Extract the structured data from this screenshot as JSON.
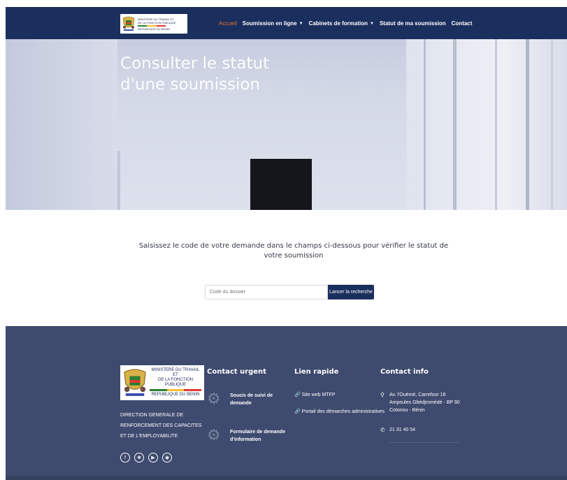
{
  "nav": {
    "logo": {
      "line1": "MINISTERE DU TRAVAIL ET",
      "line2": "DE LA FONCTION PUBLIQUE",
      "line3": "REPUBLIQUE DU BENIN"
    },
    "items": [
      {
        "label": "Accueil",
        "active": true
      },
      {
        "label": "Soumission en ligne",
        "dropdown": true
      },
      {
        "label": "Cabinets de formation",
        "dropdown": true
      },
      {
        "label": "Statut de ma soumission"
      },
      {
        "label": "Contact"
      }
    ]
  },
  "hero": {
    "title_line1": "Consulter le statut",
    "title_line2": "d'une soumission"
  },
  "search": {
    "instruction": "Saisissez le code de votre demande dans le champs ci-dessous pour vérifier le statut de votre soumission",
    "placeholder": "Code du dossier",
    "button_label": "Lancer la recherche"
  },
  "footer": {
    "logo": {
      "line1": "MINISTERE DU TRAVAIL ET",
      "line2": "DE LA FONCTION PUBLIQUE",
      "line3": "REPUBLIQUE DU BENIN"
    },
    "org_name": "DIRECTION GENERALE DE RENFORCEMENT DES CAPACITES ET DE L'EMPLOYABILITE",
    "contact_urgent": {
      "title": "Contact urgent",
      "items": [
        {
          "label": "Soucis de suivi de demande",
          "icon": "gear-icon"
        },
        {
          "label": "Formulaire de demande d'information",
          "icon": "gear-icon"
        }
      ]
    },
    "lien_rapide": {
      "title": "Lien rapide",
      "items": [
        {
          "label": "Site web MTFP",
          "icon": "link-icon"
        },
        {
          "label": "Portail des démarches administratives",
          "icon": "link-icon"
        }
      ]
    },
    "contact_info": {
      "title": "Contact info",
      "address": "Av. l'Ouémé, Carrefour 16 Ampoules Gbèdjromèdé - BP 90 Cotonou - Bénin",
      "phone": "21 31 40 54"
    },
    "social": [
      "facebook-icon",
      "twitter-icon",
      "youtube-icon",
      "instagram-icon"
    ]
  },
  "colors": {
    "nav_bg": "#1b2f5e",
    "accent": "#e8702a",
    "footer_bg": "#3e4a6e",
    "button_bg": "#1b2f5e"
  }
}
